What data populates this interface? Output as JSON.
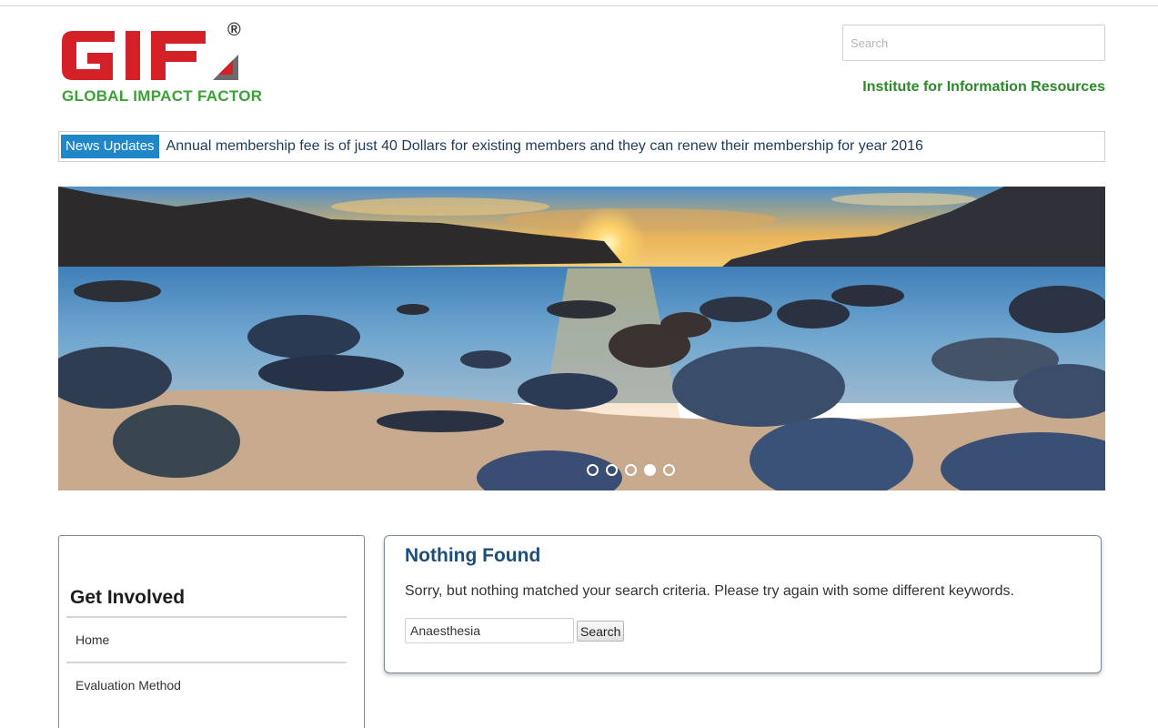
{
  "header": {
    "logo_tagline": "GLOBAL IMPACT FACTOR",
    "logo_letters": "GIF",
    "logo_reg": "®",
    "search_placeholder": "Search",
    "institute": "Institute for Information Resources"
  },
  "news": {
    "label": "News Updates",
    "text": "Annual membership fee is of just 40 Dollars for existing members and they can renew their membership for year 2016"
  },
  "slider": {
    "slide_count": 5,
    "active_index": 3
  },
  "sidebar": {
    "title": "Get Involved",
    "items": [
      {
        "label": "Home"
      },
      {
        "label": "Evaluation Method"
      }
    ]
  },
  "main": {
    "title": "Nothing Found",
    "message": "Sorry, but nothing matched your search criteria. Please try again with some different keywords.",
    "search_value": "Anaesthesia",
    "search_button": "Search"
  },
  "colors": {
    "logo_red": "#d42027",
    "logo_green": "#3aa335",
    "news_label_bg": "#1f86c7",
    "heading_blue": "#1d4e7a"
  }
}
